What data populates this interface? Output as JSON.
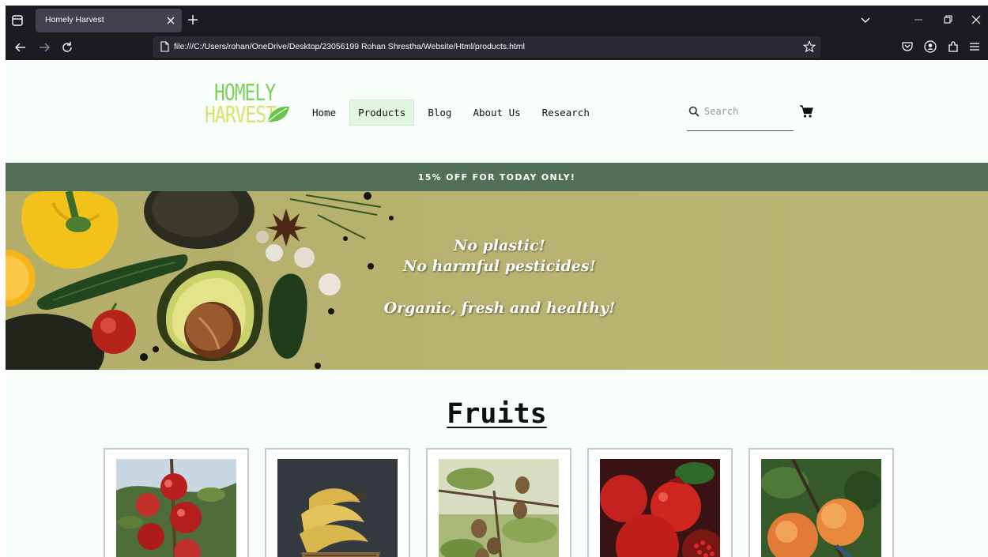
{
  "browser": {
    "tab_title": "Homely Harvest",
    "url": "file:///C:/Users/rohan/OneDrive/Desktop/23056199 Rohan Shrestha/Website/Html/products.html",
    "icons": [
      "tab-list-icon",
      "close-icon",
      "plus-icon",
      "chevron-down-icon",
      "minimize-icon",
      "restore-icon",
      "back-arrow-icon",
      "forward-arrow-icon",
      "reload-icon",
      "page-icon",
      "bookmark-star-icon",
      "pocket-icon",
      "account-icon",
      "extensions-icon",
      "menu-icon"
    ]
  },
  "site": {
    "logo_line1": "HOMELY",
    "logo_line2": "HARVEST",
    "nav": [
      {
        "label": "Home"
      },
      {
        "label": "Products"
      },
      {
        "label": "Blog"
      },
      {
        "label": "About Us"
      },
      {
        "label": "Research"
      }
    ],
    "active_nav": "Products",
    "search_placeholder": "Search",
    "promo": "15% OFF FOR TODAY ONLY!",
    "hero_lines": [
      "No plastic!",
      "No harmful pesticides!",
      "Organic, fresh and healthy!"
    ],
    "section_title": "Fruits",
    "products": [
      {
        "name": "apple"
      },
      {
        "name": "banana"
      },
      {
        "name": "kiwi"
      },
      {
        "name": "pomegranate"
      },
      {
        "name": "peach"
      }
    ]
  },
  "colors": {
    "chrome_bg": "#1c1b22",
    "page_bg": "#f7fdf8",
    "promo_bg": "#527057",
    "hero_bg": "#b7b26f",
    "active_nav_bg": "#e2f7e1",
    "logo_green": "#7fcf60",
    "logo_yellow": "#d9e36c"
  }
}
